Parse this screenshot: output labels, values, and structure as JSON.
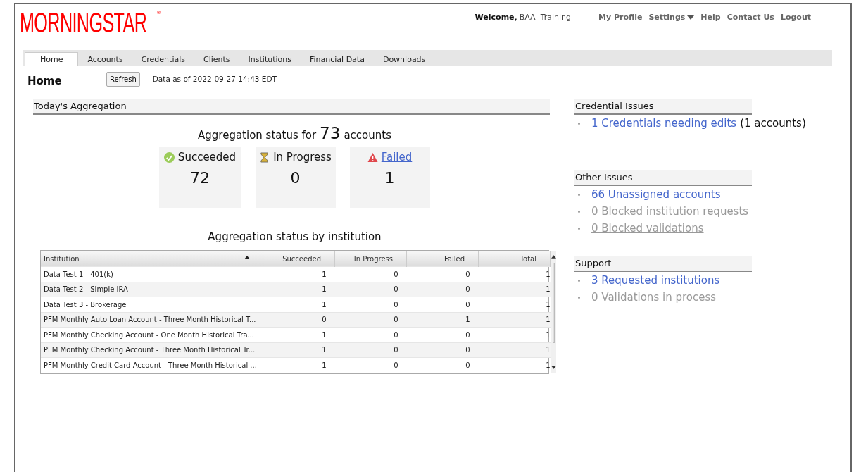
{
  "logo": {
    "text": "MORNINGSTAR",
    "mark": "®"
  },
  "welcome": {
    "label": "Welcome,",
    "user": "BAA  Training"
  },
  "top_links": [
    {
      "label": "My Profile",
      "dropdown": false
    },
    {
      "label": "Settings",
      "dropdown": true
    },
    {
      "label": "Help",
      "dropdown": false
    },
    {
      "label": "Contact Us",
      "dropdown": false
    },
    {
      "label": "Logout",
      "dropdown": false
    }
  ],
  "tabs": [
    {
      "label": "Home",
      "selected": true
    },
    {
      "label": "Accounts",
      "selected": false
    },
    {
      "label": "Credentials",
      "selected": false
    },
    {
      "label": "Clients",
      "selected": false
    },
    {
      "label": "Institutions",
      "selected": false
    },
    {
      "label": "Financial Data",
      "selected": false
    },
    {
      "label": "Downloads",
      "selected": false
    }
  ],
  "page_title": "Home",
  "refresh_button": "Refresh",
  "data_as_of": "Data as of 2022-09-27 14:43 EDT",
  "aggregation": {
    "title": "Today's Aggregation",
    "summary_prefix": "Aggregation status for",
    "summary_count": "73",
    "summary_suffix": "accounts",
    "cards": [
      {
        "kind": "succeeded",
        "label": "Succeeded",
        "link": false,
        "value": "72"
      },
      {
        "kind": "in_progress",
        "label": "In Progress",
        "link": false,
        "value": "0"
      },
      {
        "kind": "failed",
        "label": "Failed",
        "link": true,
        "value": "1"
      }
    ],
    "table_title": "Aggregation status by institution",
    "table": {
      "columns": [
        {
          "label": "Institution",
          "sorted": true
        },
        {
          "label": "Succeeded",
          "sorted": false
        },
        {
          "label": "In Progress",
          "sorted": false
        },
        {
          "label": "Failed",
          "sorted": false
        },
        {
          "label": "Total",
          "sorted": false
        }
      ],
      "rows": [
        [
          "Data Test 1 - 401(k)",
          "1",
          "0",
          "0",
          "1"
        ],
        [
          "Data Test 2 - Simple IRA",
          "1",
          "0",
          "0",
          "1"
        ],
        [
          "Data Test 3 - Brokerage",
          "1",
          "0",
          "0",
          "1"
        ],
        [
          "PFM Monthly Auto Loan Account - Three Month Historical T...",
          "0",
          "0",
          "1",
          "1"
        ],
        [
          "PFM Monthly Checking Account - One Month Historical Tra...",
          "1",
          "0",
          "0",
          "1"
        ],
        [
          "PFM Monthly Checking Account - Three Month Historical Tr...",
          "1",
          "0",
          "0",
          "1"
        ],
        [
          "PFM Monthly Credit Card Account - Three Month Historical ...",
          "1",
          "0",
          "0",
          "1"
        ]
      ]
    }
  },
  "side_sections": [
    {
      "title": "Credential Issues",
      "items": [
        {
          "link": "1 Credentials needing edits",
          "note": "(1 accounts)",
          "disabled": false
        }
      ]
    },
    {
      "title": "Other Issues",
      "items": [
        {
          "link": "66 Unassigned accounts",
          "disabled": false
        },
        {
          "link": "0 Blocked institution requests",
          "disabled": true
        },
        {
          "link": "0 Blocked validations",
          "disabled": true
        }
      ]
    },
    {
      "title": "Support",
      "items": [
        {
          "link": "3 Requested institutions",
          "disabled": false
        },
        {
          "link": "0 Validations in process",
          "disabled": true
        }
      ]
    }
  ]
}
